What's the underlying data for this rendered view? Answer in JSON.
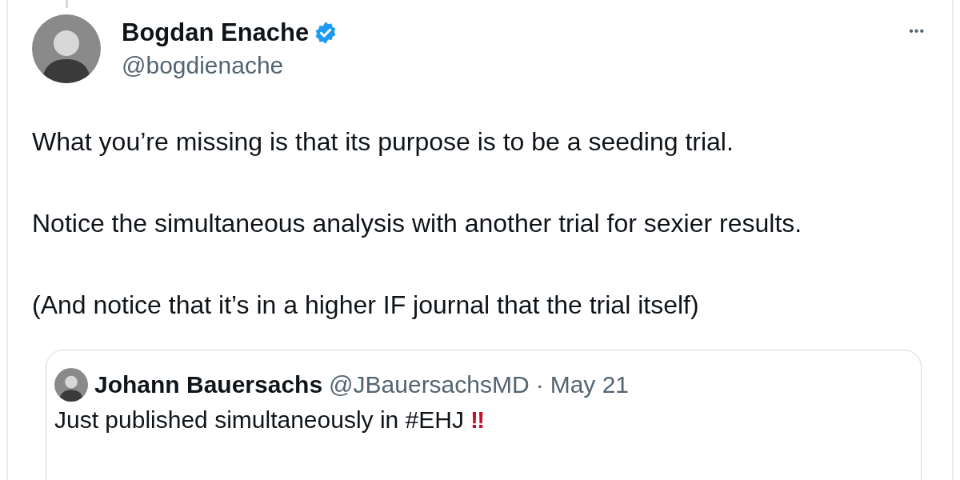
{
  "tweet": {
    "author": {
      "name": "Bogdan Enache",
      "verified": true,
      "handle": "@bogdienache"
    },
    "more_button": "•••",
    "paragraphs": [
      "What you’re missing is that its purpose is to be a seeding trial.",
      "Notice the simultaneous analysis with another trial for sexier results.",
      "(And notice that it’s in a higher IF journal that the trial itself)"
    ],
    "quoted_tweet": {
      "name": "Johann Bauersachs",
      "handle": "@JBauersachsMD",
      "separator": "·",
      "date": "May 21",
      "text": "Just published simultaneously in #EHJ",
      "emoji": "‼"
    }
  }
}
